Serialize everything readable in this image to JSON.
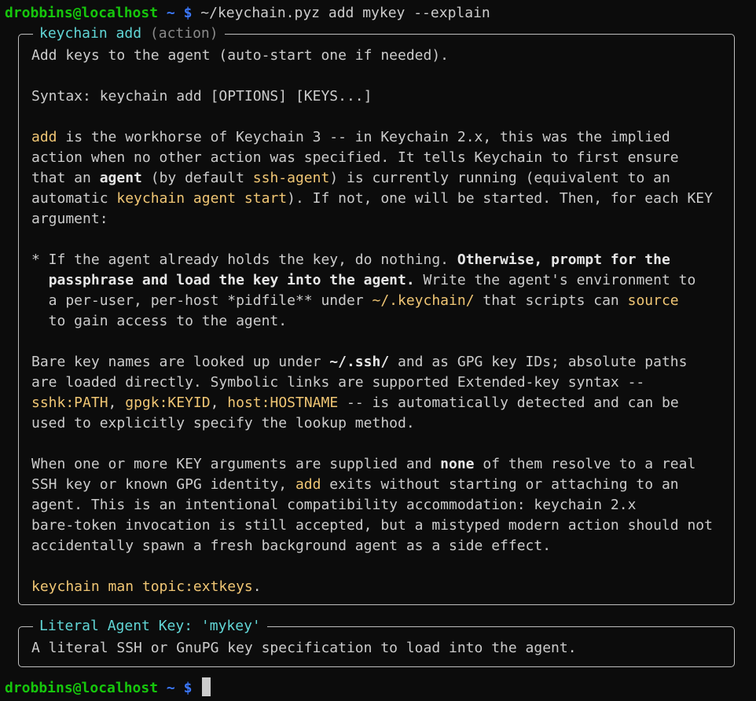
{
  "prompt": {
    "user_host": "drobbins@localhost",
    "cwd": "~",
    "symbol": "$",
    "command": "~/keychain.pyz add mykey --explain"
  },
  "panels": [
    {
      "title": "keychain add",
      "subtitle": "(action)",
      "lines": [
        [
          {
            "t": "Add keys to the agent (auto-start one if needed)."
          }
        ],
        [],
        [
          {
            "t": "Syntax: keychain add [OPTIONS] [KEYS...]"
          }
        ],
        [],
        [
          {
            "t": "add",
            "s": "y"
          },
          {
            "t": " is the workhorse of Keychain 3 -- in Keychain 2.x, this was the implied"
          }
        ],
        [
          {
            "t": "action when no other action was specified. It tells Keychain to first ensure"
          }
        ],
        [
          {
            "t": "that an "
          },
          {
            "t": "agent",
            "s": "b"
          },
          {
            "t": " (by default "
          },
          {
            "t": "ssh-agent",
            "s": "y"
          },
          {
            "t": ") is currently running (equivalent to an"
          }
        ],
        [
          {
            "t": "automatic "
          },
          {
            "t": "keychain agent start",
            "s": "y"
          },
          {
            "t": "). If not, one will be started. Then, for each KEY"
          }
        ],
        [
          {
            "t": "argument:"
          }
        ],
        [],
        [
          {
            "t": "* If the agent already holds the key, do nothing. "
          },
          {
            "t": "Otherwise, prompt for the",
            "s": "b"
          }
        ],
        [
          {
            "t": "  "
          },
          {
            "t": "passphrase and load the key into the agent.",
            "s": "b"
          },
          {
            "t": " Write the agent's environment to"
          }
        ],
        [
          {
            "t": "  a per-user, per-host *pidfile** under "
          },
          {
            "t": "~/.keychain/",
            "s": "y"
          },
          {
            "t": " that scripts can "
          },
          {
            "t": "source",
            "s": "y"
          }
        ],
        [
          {
            "t": "  to gain access to the agent."
          }
        ],
        [],
        [
          {
            "t": "Bare key names are looked up under "
          },
          {
            "t": "~/.ssh/",
            "s": "b"
          },
          {
            "t": " and as GPG key IDs; absolute paths"
          }
        ],
        [
          {
            "t": "are loaded directly. Symbolic links are supported Extended-key syntax --"
          }
        ],
        [
          {
            "t": "sshk:PATH",
            "s": "y"
          },
          {
            "t": ", "
          },
          {
            "t": "gpgk:KEYID",
            "s": "y"
          },
          {
            "t": ", "
          },
          {
            "t": "host:HOSTNAME",
            "s": "y"
          },
          {
            "t": " -- is automatically detected and can be"
          }
        ],
        [
          {
            "t": "used to explicitly specify the lookup method."
          }
        ],
        [],
        [
          {
            "t": "When one or more KEY arguments are supplied and "
          },
          {
            "t": "none",
            "s": "b"
          },
          {
            "t": " of them resolve to a real"
          }
        ],
        [
          {
            "t": "SSH key or known GPG identity, "
          },
          {
            "t": "add",
            "s": "y"
          },
          {
            "t": " exits without starting or attaching to an"
          }
        ],
        [
          {
            "t": "agent. This is an intentional compatibility accommodation: keychain 2.x"
          }
        ],
        [
          {
            "t": "bare-token invocation is still accepted, but a mistyped modern action should not"
          }
        ],
        [
          {
            "t": "accidentally spawn a fresh background agent as a side effect."
          }
        ],
        [],
        [
          {
            "t": "keychain man topic:extkeys",
            "s": "y"
          },
          {
            "t": "."
          }
        ]
      ]
    },
    {
      "title": "Literal Agent Key: 'mykey'",
      "subtitle": "",
      "lines": [
        [
          {
            "t": "A literal SSH or GnuPG key specification to load into the agent."
          }
        ]
      ]
    }
  ],
  "colors": {
    "background": "#0c0c0c",
    "text": "#cccccc",
    "prompt_user": "#16c60c",
    "prompt_path": "#3b78ff",
    "panel_title": "#61d6d6",
    "highlight": "#f0c674",
    "border": "#bfbfbf"
  }
}
